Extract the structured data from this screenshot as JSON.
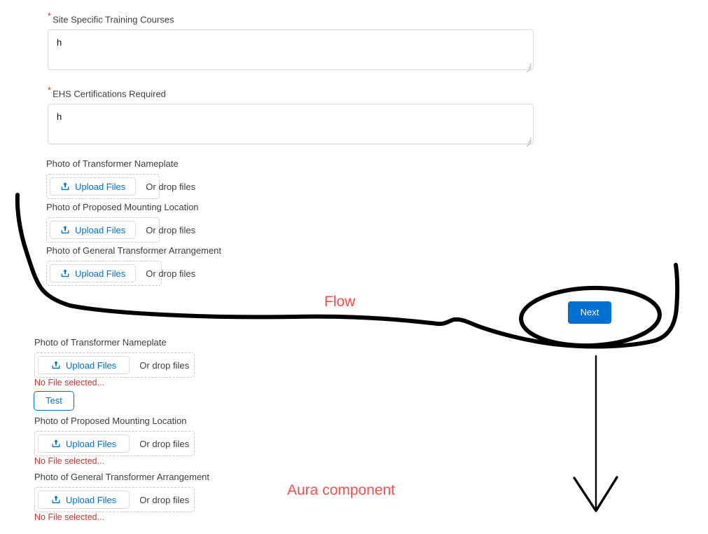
{
  "flow_section": {
    "required_fields": [
      {
        "label": "Site Specific Training Courses",
        "required_mark": "*",
        "value": "h"
      },
      {
        "label": "EHS Certifications Required",
        "required_mark": "*",
        "value": "h"
      }
    ],
    "uploads": [
      {
        "label": "Photo of Transformer Nameplate",
        "button_label": "Upload Files",
        "drop_label": "Or drop files",
        "icon": "upload-icon"
      },
      {
        "label": "Photo of Proposed Mounting Location",
        "button_label": "Upload Files",
        "drop_label": "Or drop files",
        "icon": "upload-icon"
      },
      {
        "label": "Photo of General Transformer Arrangement",
        "button_label": "Upload Files",
        "drop_label": "Or drop files",
        "icon": "upload-icon"
      }
    ],
    "next_button": "Next"
  },
  "aura_section": {
    "uploads": [
      {
        "label": "Photo of Transformer Nameplate",
        "button_label": "Upload Files",
        "drop_label": "Or drop files",
        "icon": "upload-icon",
        "status": "No File selected..."
      },
      {
        "label": "Photo of Proposed Mounting Location",
        "button_label": "Upload Files",
        "drop_label": "Or drop files",
        "icon": "upload-icon",
        "status": "No File selected..."
      },
      {
        "label": "Photo of General Transformer Arrangement",
        "button_label": "Upload Files",
        "drop_label": "Or drop files",
        "icon": "upload-icon",
        "status": "No File selected..."
      }
    ],
    "test_button": "Test"
  },
  "annotations": {
    "flow_label": "Flow",
    "aura_label": "Aura component",
    "color": "#fc4b4b",
    "ink_color": "#000000"
  },
  "colors": {
    "brand_blue": "#0070d2",
    "error_red": "#c23934",
    "label_gray": "#3e3e3c",
    "border_gray": "#dddbda",
    "dashed_gray": "#c9c7c5"
  }
}
